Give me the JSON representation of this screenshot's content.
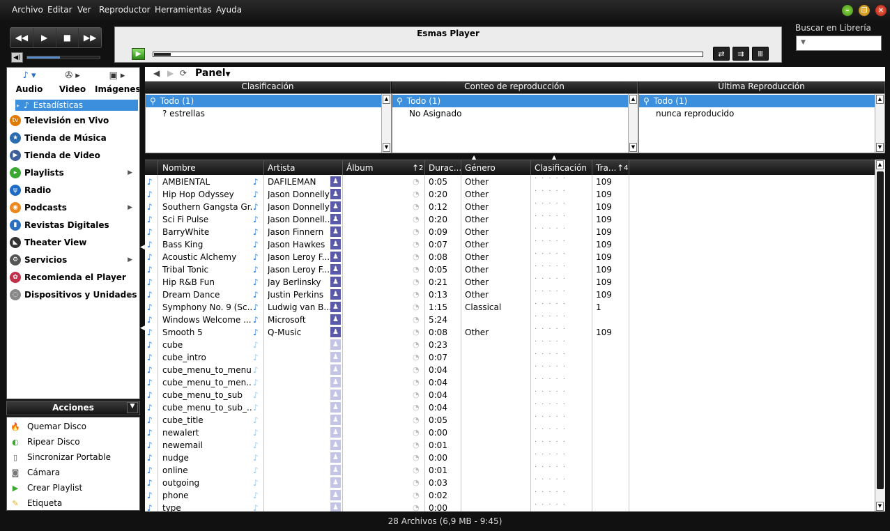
{
  "menu": [
    "Archivo",
    "Editar",
    "Ver",
    "Reproductor",
    "Herramientas",
    "Ayuda"
  ],
  "player": {
    "title": "Esmas Player",
    "progress": 0.03,
    "volume": 0.45
  },
  "search": {
    "label": "Buscar en Librería",
    "placeholder": ""
  },
  "categories": [
    {
      "label": "Audio",
      "icon": "music-note-icon"
    },
    {
      "label": "Video",
      "icon": "film-reel-icon"
    },
    {
      "label": "Imágenes",
      "icon": "image-icon"
    }
  ],
  "library": {
    "selected": "Estadísticas",
    "items": [
      {
        "label": "Televisión en Vivo",
        "icon": "tv-icon",
        "color": "#e07b00",
        "arrow": false
      },
      {
        "label": "Tienda de Música",
        "icon": "store-icon",
        "color": "#2b6cb0",
        "arrow": false
      },
      {
        "label": "Tienda de Video",
        "icon": "video-store-icon",
        "color": "#3e5f9a",
        "arrow": false
      },
      {
        "label": "Playlists",
        "icon": "playlist-icon",
        "color": "#3aa832",
        "arrow": true
      },
      {
        "label": "Radio",
        "icon": "radio-icon",
        "color": "#1f6bc4",
        "arrow": false
      },
      {
        "label": "Podcasts",
        "icon": "podcast-icon",
        "color": "#e8881e",
        "arrow": true
      },
      {
        "label": "Revistas Digitales",
        "icon": "magazine-icon",
        "color": "#2a6fc0",
        "arrow": false
      },
      {
        "label": "Theater View",
        "icon": "theater-icon",
        "color": "#333333",
        "arrow": false
      },
      {
        "label": "Servicios",
        "icon": "services-icon",
        "color": "#555555",
        "arrow": true
      },
      {
        "label": "Recomienda el Player",
        "icon": "recommend-icon",
        "color": "#c0304a",
        "arrow": false
      },
      {
        "label": "Dispositivos y Unidades",
        "icon": "devices-icon",
        "color": "#888888",
        "arrow": true
      }
    ]
  },
  "actions": {
    "title": "Acciones",
    "items": [
      {
        "label": "Quemar Disco",
        "icon": "burn-disc-icon"
      },
      {
        "label": "Ripear Disco",
        "icon": "rip-disc-icon"
      },
      {
        "label": "Sincronizar Portable",
        "icon": "portable-icon"
      },
      {
        "label": "Cámara",
        "icon": "camera-icon"
      },
      {
        "label": "Crear Playlist",
        "icon": "create-playlist-icon"
      },
      {
        "label": "Etiqueta",
        "icon": "tag-icon"
      }
    ]
  },
  "panel": {
    "label": "Panel",
    "columns": [
      {
        "title": "Clasificación",
        "rows": [
          "Todo (1)",
          "? estrellas"
        ]
      },
      {
        "title": "Conteo de reproducción",
        "rows": [
          "Todo (1)",
          "No Asignado"
        ]
      },
      {
        "title": "Última Reproducción",
        "rows": [
          "Todo (1)",
          "nunca reproducido"
        ]
      }
    ]
  },
  "tracks": {
    "headers": {
      "name": "Nombre",
      "artist": "Artista",
      "album": "Álbum",
      "album_sort": "2",
      "duration": "Durac...",
      "genre": "Género",
      "rating": "Clasificación",
      "track": "Tra...",
      "track_sort": "4"
    },
    "rows": [
      {
        "name": "AMBIENTAL",
        "artist": "DAFILEMAN",
        "duration": "0:05",
        "genre": "Other",
        "track": "109"
      },
      {
        "name": "Hip Hop Odyssey",
        "artist": "Jason Donnelly",
        "duration": "0:20",
        "genre": "Other",
        "track": "109"
      },
      {
        "name": "Southern Gangsta Gr...",
        "artist": "Jason Donnelly",
        "duration": "0:12",
        "genre": "Other",
        "track": "109"
      },
      {
        "name": "Sci Fi Pulse",
        "artist": "Jason Donnell...",
        "duration": "0:20",
        "genre": "Other",
        "track": "109"
      },
      {
        "name": "BarryWhite",
        "artist": "Jason Finnern",
        "duration": "0:09",
        "genre": "Other",
        "track": "109"
      },
      {
        "name": "Bass King",
        "artist": "Jason Hawkes",
        "duration": "0:07",
        "genre": "Other",
        "track": "109"
      },
      {
        "name": "Acoustic Alchemy",
        "artist": "Jason Leroy F...",
        "duration": "0:08",
        "genre": "Other",
        "track": "109"
      },
      {
        "name": "Tribal Tonic",
        "artist": "Jason Leroy F...",
        "duration": "0:05",
        "genre": "Other",
        "track": "109"
      },
      {
        "name": "Hip R&B Fun",
        "artist": "Jay Berlinsky",
        "duration": "0:21",
        "genre": "Other",
        "track": "109"
      },
      {
        "name": "Dream Dance",
        "artist": "Justin Perkins",
        "duration": "0:13",
        "genre": "Other",
        "track": "109"
      },
      {
        "name": "Symphony No. 9 (Sc...",
        "artist": "Ludwig van B...",
        "duration": "1:15",
        "genre": "Classical",
        "track": "1"
      },
      {
        "name": "Windows Welcome ...",
        "artist": "Microsoft",
        "duration": "5:24",
        "genre": "",
        "track": ""
      },
      {
        "name": "Smooth 5",
        "artist": "Q-Music",
        "duration": "0:08",
        "genre": "Other",
        "track": "109"
      },
      {
        "name": "cube",
        "artist": "",
        "duration": "0:23",
        "genre": "",
        "track": ""
      },
      {
        "name": "cube_intro",
        "artist": "",
        "duration": "0:07",
        "genre": "",
        "track": ""
      },
      {
        "name": "cube_menu_to_menu",
        "artist": "",
        "duration": "0:04",
        "genre": "",
        "track": ""
      },
      {
        "name": "cube_menu_to_men...",
        "artist": "",
        "duration": "0:04",
        "genre": "",
        "track": ""
      },
      {
        "name": "cube_menu_to_sub",
        "artist": "",
        "duration": "0:04",
        "genre": "",
        "track": ""
      },
      {
        "name": "cube_menu_to_sub_...",
        "artist": "",
        "duration": "0:04",
        "genre": "",
        "track": ""
      },
      {
        "name": "cube_title",
        "artist": "",
        "duration": "0:05",
        "genre": "",
        "track": ""
      },
      {
        "name": "newalert",
        "artist": "",
        "duration": "0:00",
        "genre": "",
        "track": ""
      },
      {
        "name": "newemail",
        "artist": "",
        "duration": "0:01",
        "genre": "",
        "track": ""
      },
      {
        "name": "nudge",
        "artist": "",
        "duration": "0:00",
        "genre": "",
        "track": ""
      },
      {
        "name": "online",
        "artist": "",
        "duration": "0:01",
        "genre": "",
        "track": ""
      },
      {
        "name": "outgoing",
        "artist": "",
        "duration": "0:03",
        "genre": "",
        "track": ""
      },
      {
        "name": "phone",
        "artist": "",
        "duration": "0:02",
        "genre": "",
        "track": ""
      },
      {
        "name": "type",
        "artist": "",
        "duration": "0:00",
        "genre": "",
        "track": ""
      }
    ]
  },
  "status": "28 Archivos (6,9 MB - 9:45)"
}
